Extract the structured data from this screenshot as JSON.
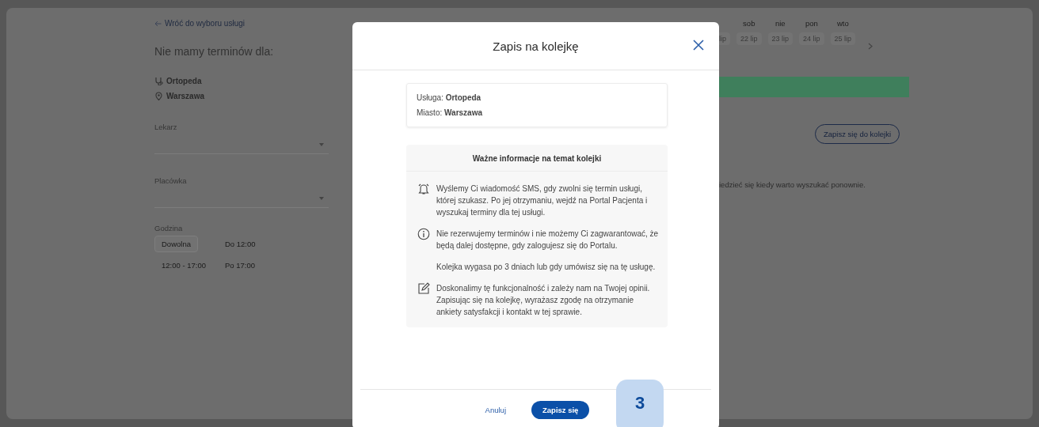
{
  "back_link": "Wróć do wyboru usługi",
  "heading": "Nie mamy terminów dla:",
  "criteria": [
    {
      "kind": "service",
      "text": "Ortopeda"
    },
    {
      "kind": "city",
      "text": "Warszawa"
    }
  ],
  "filters": [
    {
      "label": "Lekarz"
    },
    {
      "label": "Placówka"
    }
  ],
  "hour_filter": {
    "label": "Godzina",
    "options": [
      {
        "label": "Dowolna",
        "selected": true
      },
      {
        "label": "Do 12:00",
        "selected": false
      },
      {
        "label": "12:00 - 17:00",
        "selected": false
      },
      {
        "label": "Po 17:00",
        "selected": false
      }
    ]
  },
  "days": [
    {
      "date": "lip"
    },
    {
      "weekday": "sob",
      "date": "22 lip"
    },
    {
      "weekday": "nie",
      "date": "23 lip"
    },
    {
      "weekday": "pon",
      "date": "24 lip"
    },
    {
      "weekday": "wto",
      "date": "25 lip"
    }
  ],
  "queue_button": "Zapisz się do kolejki",
  "hint": "iedzieć się kiedy warto wyszukać ponownie.",
  "modal": {
    "title": "Zapis na kolejkę",
    "summary": [
      "Usługa: **Ortopeda**",
      "Miasto: **Warszawa**"
    ],
    "info_title": "Ważne informacje na temat kolejki",
    "info": [
      {
        "kind": "bell",
        "text": "Wyślemy Ci wiadomość SMS, gdy zwolni się termin usługi, której szukasz. Po jej otrzymaniu, wejdź na Portal Pacjenta i wyszukaj terminy dla tej usługi."
      },
      {
        "kind": "info",
        "text": "Nie rezerwujemy terminów i nie możemy Ci zagwarantować, że będą dalej dostępne, gdy zalogujesz się do Portalu."
      },
      {
        "kind": "note",
        "text": "Kolejka wygasa po 3 dniach lub gdy umówisz się na tę usługę."
      },
      {
        "kind": "edit",
        "text": "Doskonalimy tę funkcjonalność i zależy nam na Twojej opinii. Zapisując się na kolejkę, wyrażasz zgodę na otrzymanie ankiety satysfakcji i kontakt w tej sprawie."
      }
    ],
    "cancel": "Anuluj",
    "confirm": "Zapisz się"
  },
  "step_badge": "3"
}
